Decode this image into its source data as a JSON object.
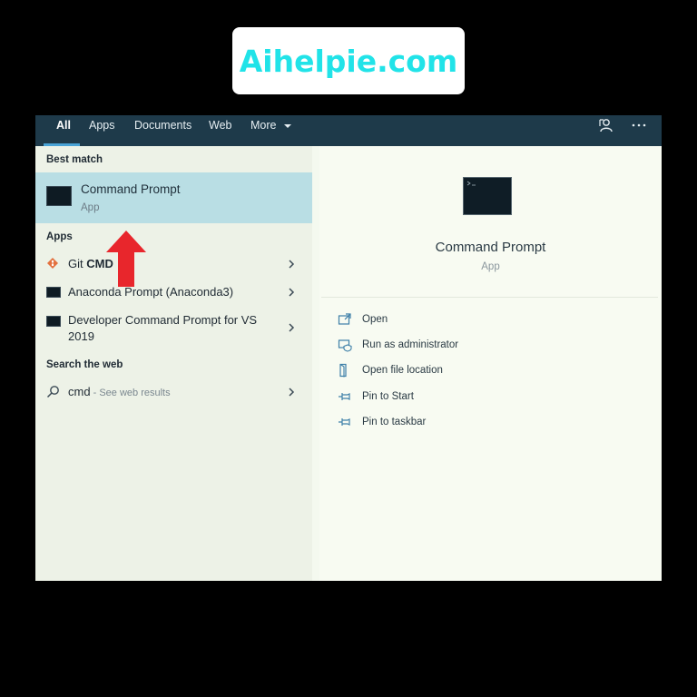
{
  "watermark": {
    "text": "Aihelpie.com"
  },
  "tabs": [
    {
      "label": "All",
      "active": true
    },
    {
      "label": "Apps"
    },
    {
      "label": "Documents"
    },
    {
      "label": "Web"
    },
    {
      "label": "More"
    }
  ],
  "left_panel": {
    "best_match_header": "Best match",
    "best_match": {
      "title": "Command Prompt",
      "subtitle": "App"
    },
    "apps_header": "Apps",
    "apps": [
      {
        "label_plain": "Git ",
        "label_bold": "CMD"
      },
      {
        "label": "Anaconda Prompt (Anaconda3)"
      },
      {
        "label_line1": "Developer Command Prompt for VS",
        "label_line2": "2019"
      }
    ],
    "web_header": "Search the web",
    "web_result": {
      "query": "cmd",
      "hint": " - See web results"
    }
  },
  "right_panel": {
    "title": "Command Prompt",
    "subtitle": "App",
    "actions": [
      {
        "label": "Open",
        "icon": "open-icon"
      },
      {
        "label": "Run as administrator",
        "icon": "shield-icon"
      },
      {
        "label": "Open file location",
        "icon": "folder-icon"
      },
      {
        "label": "Pin to Start",
        "icon": "pin-icon"
      },
      {
        "label": "Pin to taskbar",
        "icon": "pin-icon"
      }
    ]
  },
  "colors": {
    "topbar": "#1e3a4a",
    "accent_underline": "#49a3d6",
    "best_match_highlight": "#b9dee4",
    "watermark_text": "#21e3e8",
    "annotation_arrow": "#e8262c"
  }
}
